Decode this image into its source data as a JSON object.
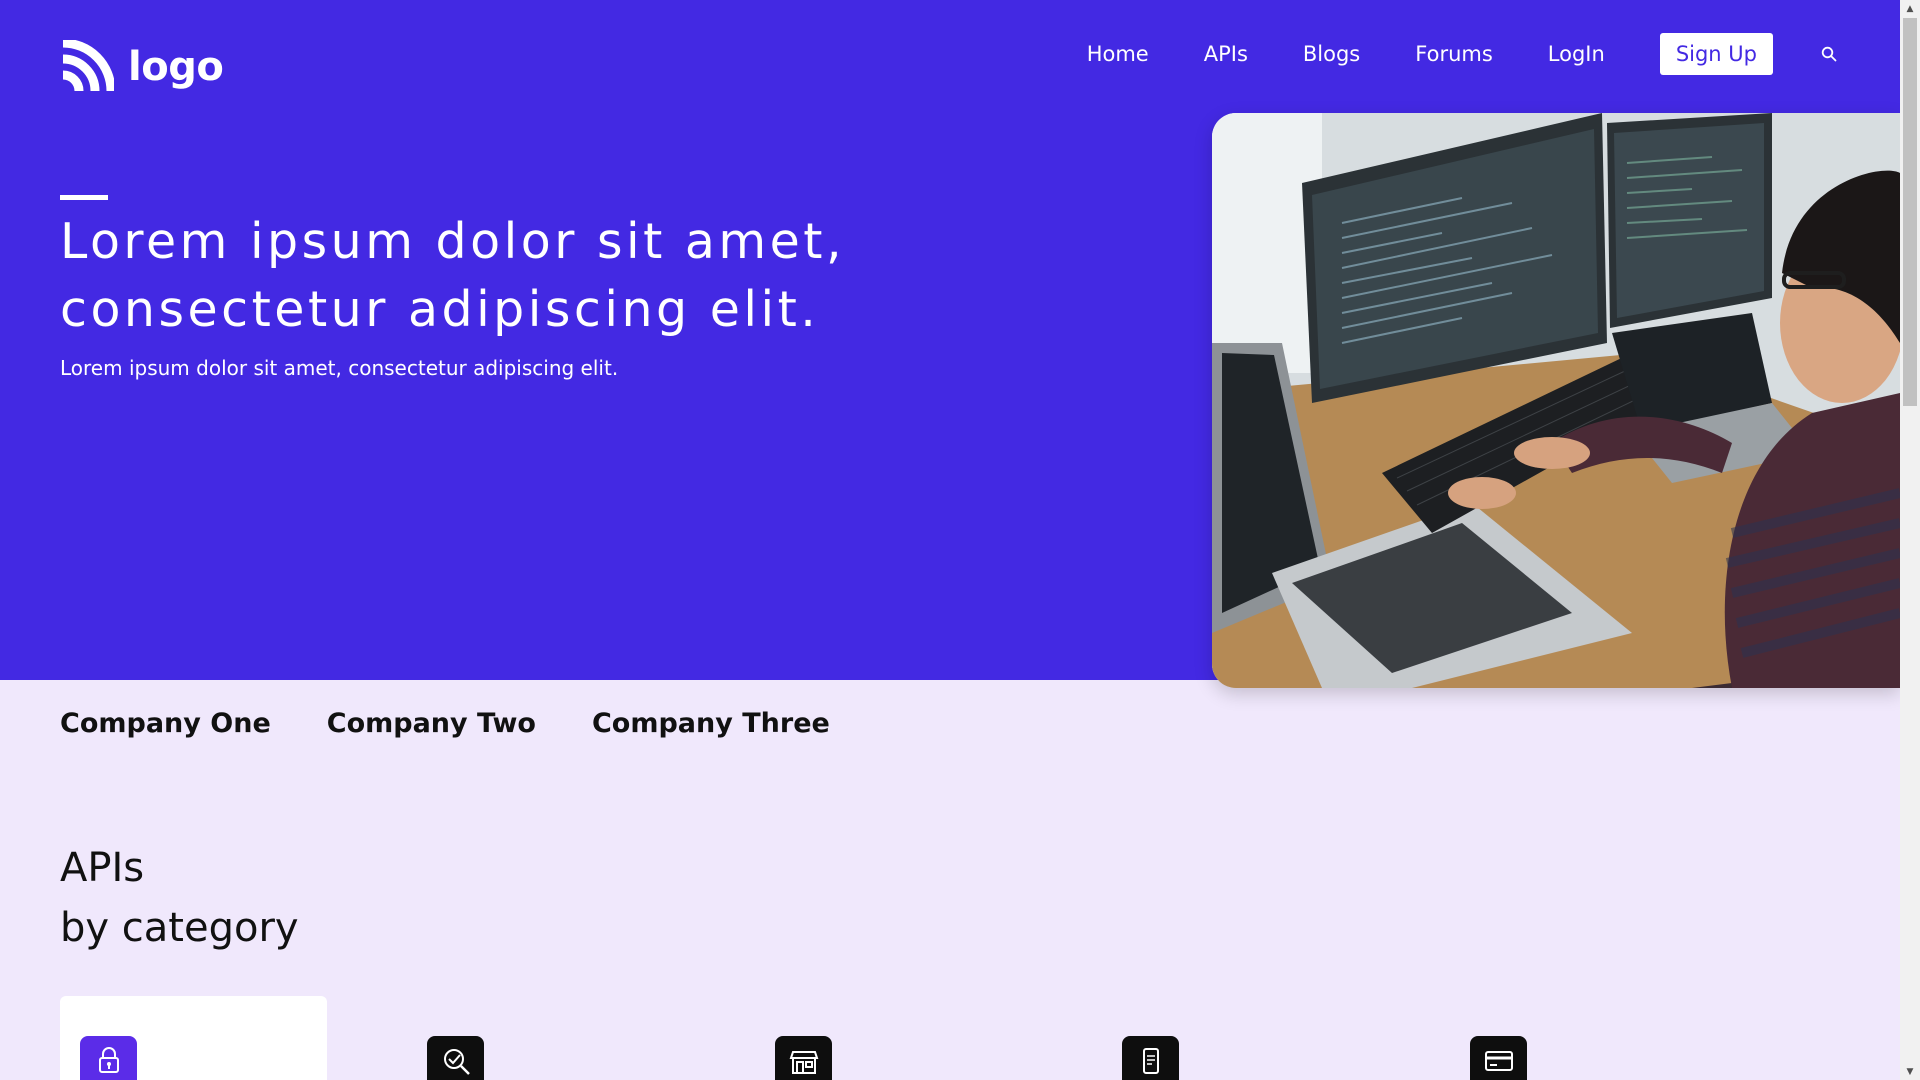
{
  "header": {
    "logo_text": "logo",
    "nav": {
      "home": "Home",
      "apis": "APIs",
      "blogs": "Blogs",
      "forums": "Forums",
      "login": "LogIn",
      "signup": "Sign Up"
    }
  },
  "hero": {
    "title_line1": "Lorem ipsum dolor sit amet,",
    "title_line2": "consectetur adipiscing elit.",
    "subtitle": "Lorem ipsum dolor sit amet, consectetur adipiscing elit."
  },
  "companies": [
    "Company One",
    "Company Two",
    "Company Three"
  ],
  "section": {
    "title_line1": "APIs",
    "title_line2": "by category"
  },
  "categories": [
    {
      "icon": "lock-icon",
      "active": true
    },
    {
      "icon": "search-check-icon",
      "active": false
    },
    {
      "icon": "store-icon",
      "active": false
    },
    {
      "icon": "mobile-document-icon",
      "active": false
    },
    {
      "icon": "credit-card-icon",
      "active": false
    }
  ],
  "colors": {
    "hero_bg": "#4329e3",
    "page_bg": "#f0e8fc",
    "accent": "#5b2ce8",
    "text_dark": "#111111"
  }
}
